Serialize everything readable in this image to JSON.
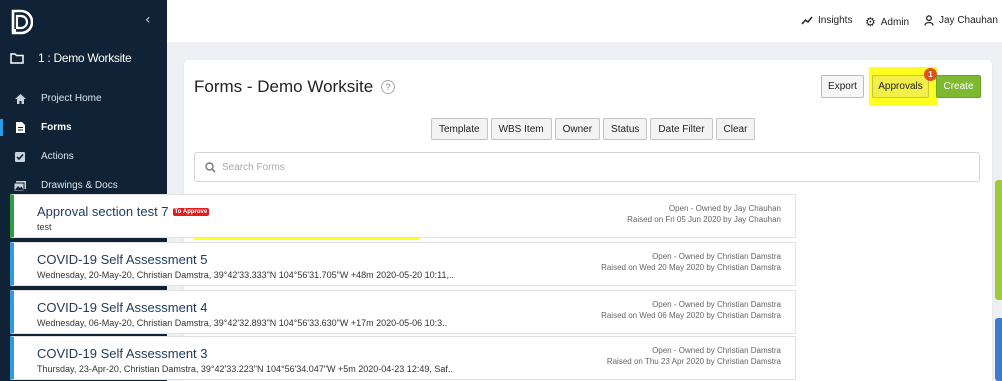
{
  "app": {
    "brand_icon": "logo-icon"
  },
  "sidebar": {
    "collapse_label": "‹",
    "workspace_label": "1 : Demo Worksite",
    "items": [
      {
        "label": "Project Home",
        "icon": "home-icon",
        "active": false
      },
      {
        "label": "Forms",
        "icon": "document-icon",
        "active": true
      },
      {
        "label": "Actions",
        "icon": "checkbox-icon",
        "active": false
      },
      {
        "label": "Drawings & Docs",
        "icon": "images-icon",
        "active": false
      }
    ]
  },
  "topbar": {
    "insights_label": "Insights",
    "admin_label": "Admin",
    "user_label": "Jay Chauhan"
  },
  "page": {
    "title": "Forms - Demo Worksite",
    "export_label": "Export",
    "approvals_label": "Approvals",
    "approvals_badge": "1",
    "create_label": "Create"
  },
  "filters": [
    "Template",
    "WBS Item",
    "Owner",
    "Status",
    "Date Filter",
    "Clear"
  ],
  "search": {
    "placeholder": "Search Forms",
    "value": ""
  },
  "forms": [
    {
      "title": "Approval section test 7",
      "tag": "To Approve",
      "subtitle": "test",
      "status": "Open - Owned by Jay Chauhan",
      "raised": "Raised on Fri 05 Jun 2020 by Jay Chauhan"
    },
    {
      "title": "COVID-19 Self Assessment 5",
      "subtitle": "Wednesday, 20-May-20, Christian Damstra, 39°42'33.333\"N 104°56'31.705\"W +48m 2020-05-20 10:11,..",
      "status": "Open - Owned by Christian Damstra",
      "raised": "Raised on Wed 20 May 2020 by Christian Damstra"
    },
    {
      "title": "COVID-19 Self Assessment 4",
      "subtitle": "Wednesday, 06-May-20, Christian Damstra, 39°42'32.893\"N 104°56'33.630\"W +17m 2020-05-06 10:3..",
      "status": "Open - Owned by Christian Damstra",
      "raised": "Raised on Wed 06 May 2020 by Christian Damstra"
    },
    {
      "title": "COVID-19 Self Assessment 3",
      "subtitle": "Thursday, 23-Apr-20, Christian Damstra, 39°42'33.223\"N 104°56'34.047\"W +5m 2020-04-23 12:49, Saf..",
      "status": "Open - Owned by Christian Damstra",
      "raised": "Raised on Thu 23 Apr 2020 by Christian Damstra"
    }
  ],
  "colors": {
    "sidebar_bg": "#0f2236",
    "accent_blue": "#2f9ae0",
    "create_green": "#7dba2f",
    "highlight_yellow": "#ffff20",
    "tag_red": "#e02020"
  }
}
